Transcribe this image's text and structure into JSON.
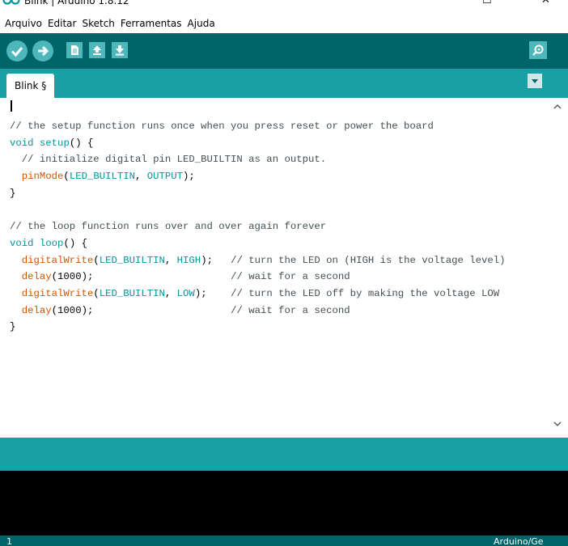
{
  "window": {
    "title": "Blink | Arduino 1.8.12",
    "maximize_glyph": "☐",
    "close_glyph": "✕"
  },
  "menu": {
    "items": [
      "Arquivo",
      "Editar",
      "Sketch",
      "Ferramentas",
      "Ajuda"
    ]
  },
  "toolbar": {
    "icons": [
      "verify-icon",
      "upload-icon",
      "new-file-icon",
      "open-icon",
      "save-icon",
      "serial-monitor-icon"
    ]
  },
  "tabs": [
    {
      "label": "Blink §"
    }
  ],
  "editor": {
    "lines": [
      [
        {
          "t": "// the setup function runs once when you press reset or power the board",
          "c": "comment"
        }
      ],
      [
        {
          "t": "void",
          "c": "kw"
        },
        {
          "t": " ",
          "c": "plain"
        },
        {
          "t": "setup",
          "c": "kw"
        },
        {
          "t": "() {",
          "c": "plain"
        }
      ],
      [
        {
          "t": "  // initialize digital pin LED_BUILTIN as an output.",
          "c": "comment"
        }
      ],
      [
        {
          "t": "  ",
          "c": "plain"
        },
        {
          "t": "pinMode",
          "c": "fn"
        },
        {
          "t": "(",
          "c": "plain"
        },
        {
          "t": "LED_BUILTIN",
          "c": "kw"
        },
        {
          "t": ", ",
          "c": "plain"
        },
        {
          "t": "OUTPUT",
          "c": "kw"
        },
        {
          "t": ");",
          "c": "plain"
        }
      ],
      [
        {
          "t": "}",
          "c": "plain"
        }
      ],
      [
        {
          "t": "",
          "c": "plain"
        }
      ],
      [
        {
          "t": "// the loop function runs over and over again forever",
          "c": "comment"
        }
      ],
      [
        {
          "t": "void",
          "c": "kw"
        },
        {
          "t": " ",
          "c": "plain"
        },
        {
          "t": "loop",
          "c": "kw"
        },
        {
          "t": "() {",
          "c": "plain"
        }
      ],
      [
        {
          "t": "  ",
          "c": "plain"
        },
        {
          "t": "digitalWrite",
          "c": "fn"
        },
        {
          "t": "(",
          "c": "plain"
        },
        {
          "t": "LED_BUILTIN",
          "c": "kw"
        },
        {
          "t": ", ",
          "c": "plain"
        },
        {
          "t": "HIGH",
          "c": "kw"
        },
        {
          "t": ");   ",
          "c": "plain"
        },
        {
          "t": "// turn the LED on (HIGH is the voltage level)",
          "c": "comment"
        }
      ],
      [
        {
          "t": "  ",
          "c": "plain"
        },
        {
          "t": "delay",
          "c": "fn"
        },
        {
          "t": "(1000);                       ",
          "c": "plain"
        },
        {
          "t": "// wait for a second",
          "c": "comment"
        }
      ],
      [
        {
          "t": "  ",
          "c": "plain"
        },
        {
          "t": "digitalWrite",
          "c": "fn"
        },
        {
          "t": "(",
          "c": "plain"
        },
        {
          "t": "LED_BUILTIN",
          "c": "kw"
        },
        {
          "t": ", ",
          "c": "plain"
        },
        {
          "t": "LOW",
          "c": "kw"
        },
        {
          "t": ");    ",
          "c": "plain"
        },
        {
          "t": "// turn the LED off by making the voltage LOW",
          "c": "comment"
        }
      ],
      [
        {
          "t": "  ",
          "c": "plain"
        },
        {
          "t": "delay",
          "c": "fn"
        },
        {
          "t": "(1000);                       ",
          "c": "plain"
        },
        {
          "t": "// wait for a second",
          "c": "comment"
        }
      ],
      [
        {
          "t": "}",
          "c": "plain"
        }
      ]
    ]
  },
  "footer": {
    "line_number": "1",
    "board": "Arduino/Ge"
  },
  "colors": {
    "toolbar": "#006468",
    "tab_strip": "#17a1a5",
    "button": "#4db7bb",
    "keyword": "#00979c",
    "function": "#d35400",
    "console": "#000000"
  }
}
